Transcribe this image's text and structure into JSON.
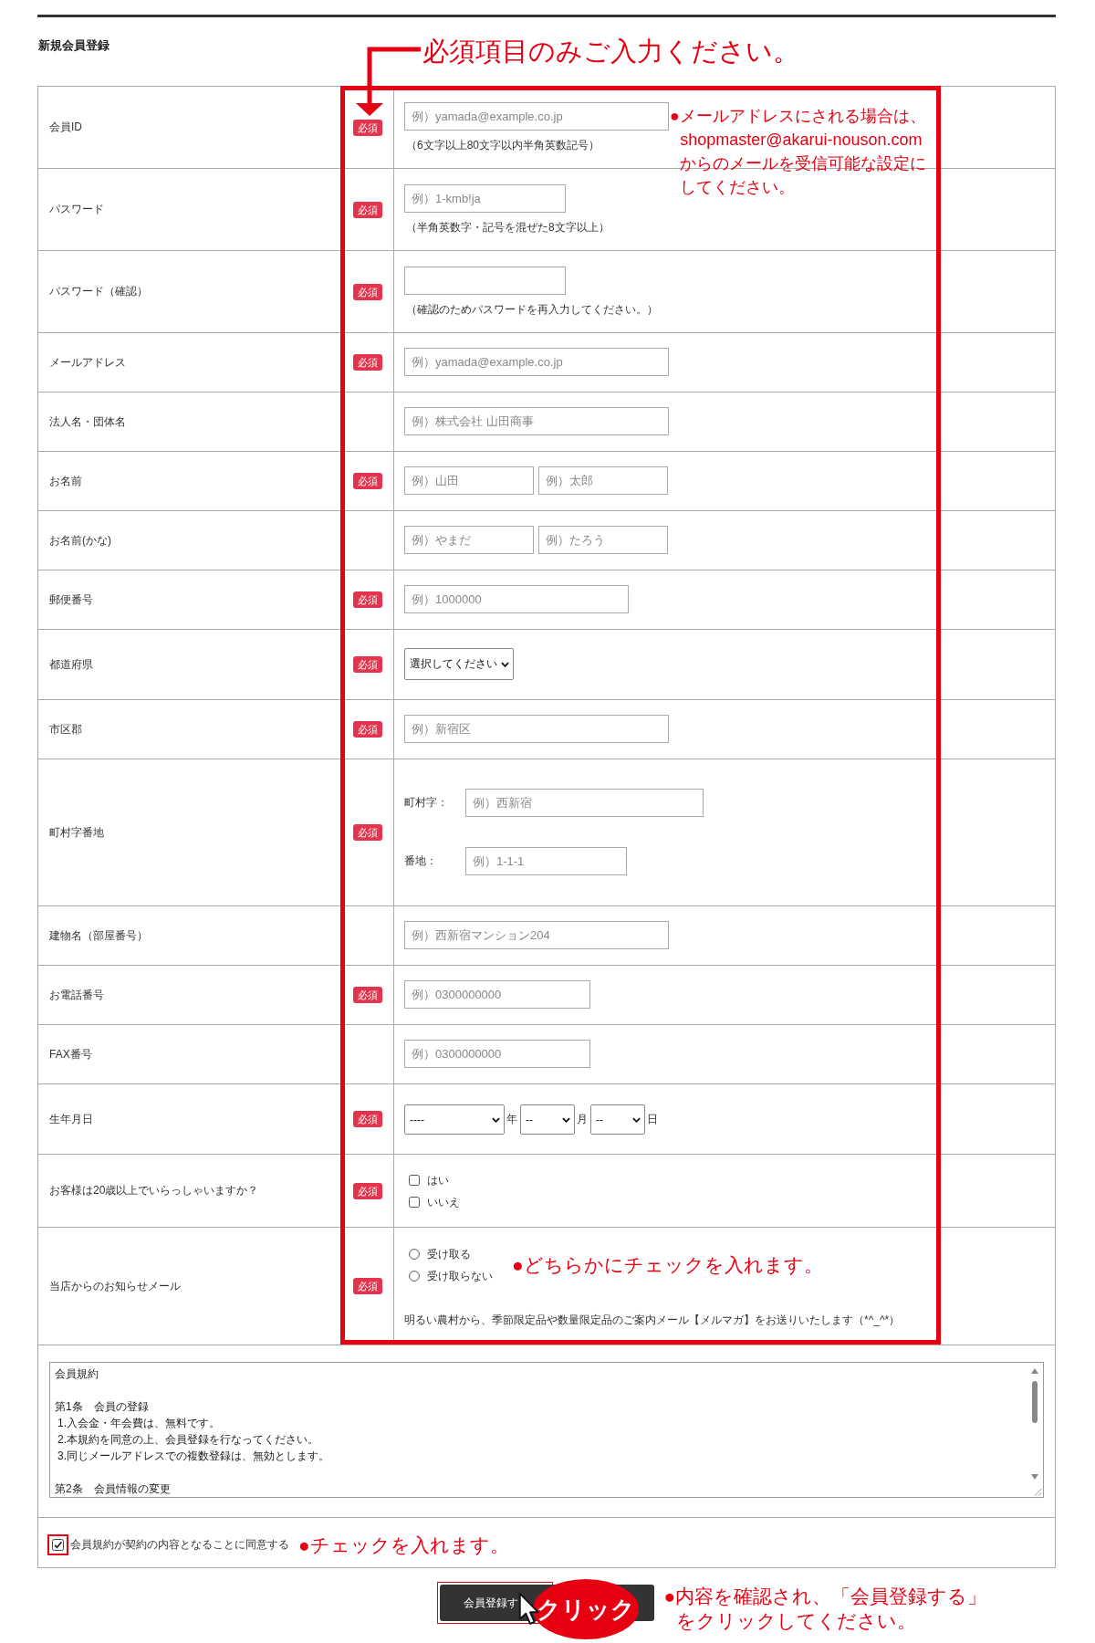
{
  "header": {
    "title": "新規会員登録",
    "required_note": "必須項目のみご入力ください。"
  },
  "form": {
    "highlighted": true,
    "rows": [
      {
        "label": "会員ID",
        "badge": "必須",
        "kind": "input",
        "fields": [
          {
            "kind": "email",
            "placeholder": "例）yamada@example.co.jp"
          }
        ],
        "hint": "（6文字以上80文字以内半角英数記号）",
        "callout": [
          "●メールアドレスにされる場合は、",
          "shopmaster@akarui-nouson.com",
          "からのメールを受信可能な設定に",
          "してください。"
        ]
      },
      {
        "label": "パスワード",
        "badge": "必須",
        "kind": "input",
        "fields": [
          {
            "kind": "password",
            "placeholder": "例）1-kmb!ja"
          }
        ],
        "hint": "（半角英数字・記号を混ぜた8文字以上）"
      },
      {
        "label": "パスワード（確認）",
        "badge": "必須",
        "kind": "input",
        "fields": [
          {
            "kind": "password"
          }
        ],
        "hint": "（確認のためパスワードを再入力してください。）"
      },
      {
        "label": "メールアドレス",
        "badge": "必須",
        "kind": "input",
        "fields": [
          {
            "kind": "email",
            "placeholder": "例）yamada@example.co.jp"
          }
        ]
      },
      {
        "label": "法人名・団体名",
        "kind": "input",
        "fields": [
          {
            "kind": "text",
            "placeholder": "例）株式会社 山田商事"
          }
        ]
      },
      {
        "label": "お名前",
        "badge": "必須",
        "kind": "input",
        "fields": [
          {
            "kind": "name",
            "placeholder": "例）山田"
          },
          {
            "kind": "name",
            "placeholder": "例）太郎"
          }
        ]
      },
      {
        "label": "お名前(かな)",
        "kind": "input",
        "fields": [
          {
            "kind": "name",
            "placeholder": "例）やまだ"
          },
          {
            "kind": "name",
            "placeholder": "例）たろう"
          }
        ]
      },
      {
        "label": "郵便番号",
        "badge": "必須",
        "kind": "input",
        "fields": [
          {
            "kind": "postal",
            "placeholder": "例）1000000"
          }
        ]
      },
      {
        "label": "都道府県",
        "badge": "必須",
        "kind": "select",
        "select": {
          "value": "選択してください"
        }
      },
      {
        "label": "市区郡",
        "badge": "必須",
        "kind": "input",
        "fields": [
          {
            "kind": "text",
            "placeholder": "例）新宿区"
          }
        ]
      },
      {
        "label": "町村字番地",
        "badge": "必須",
        "kind": "address",
        "parts": [
          {
            "label": "町村字：",
            "kind": "town",
            "placeholder": "例）西新宿"
          },
          {
            "label": "番地：",
            "kind": "lot",
            "placeholder": "例）1-1-1"
          }
        ]
      },
      {
        "label": "建物名（部屋番号）",
        "kind": "input",
        "fields": [
          {
            "kind": "text",
            "placeholder": "例）西新宿マンション204"
          }
        ]
      },
      {
        "label": "お電話番号",
        "badge": "必須",
        "kind": "input",
        "fields": [
          {
            "kind": "tel",
            "placeholder": "例）0300000000"
          }
        ]
      },
      {
        "label": "FAX番号",
        "kind": "input",
        "fields": [
          {
            "kind": "tel",
            "placeholder": "例）0300000000"
          }
        ]
      },
      {
        "label": "生年月日",
        "badge": "必須",
        "kind": "date",
        "selects": [
          {
            "kind": "year",
            "value": "----",
            "unit": "年"
          },
          {
            "kind": "month",
            "value": "--",
            "unit": "月"
          },
          {
            "kind": "day",
            "value": "--",
            "unit": "日"
          }
        ]
      },
      {
        "label": "お客様は20歳以上でいらっしゃいますか？",
        "badge": "必須",
        "kind": "checkboxes",
        "options": [
          {
            "label": "はい",
            "checked": false
          },
          {
            "label": "いいえ",
            "checked": false
          }
        ]
      },
      {
        "label": "当店からのお知らせメール",
        "badge": "必須",
        "kind": "radios",
        "options": [
          {
            "label": "受け取る",
            "selected": false
          },
          {
            "label": "受け取らない",
            "selected": false
          }
        ],
        "note": "明るい農村から、季節限定品や数量限定品のご案内メール【メルマガ】をお送りいたします（*^_^*）",
        "callout": [
          "●どちらかにチェックを入れます。"
        ]
      }
    ]
  },
  "terms": {
    "title": "会員規約",
    "sections": [
      {
        "heading": "第1条　会員の登録",
        "items": [
          "1.入会金・年会費は、無料です。",
          "2.本規約を同意の上、会員登録を行なってください。",
          "3.同じメールアドレスでの複数登録は、無効とします。"
        ]
      },
      {
        "heading": "第2条　会員情報の変更"
      }
    ]
  },
  "agreement": {
    "label": "会員規約が契約の内容となることに同意する",
    "checked": true,
    "highlighted": true,
    "callout": [
      "●チェックを入れます。"
    ]
  },
  "submit": {
    "label": "会員登録す",
    "highlighted": true,
    "click_badge": "クリック",
    "callout": [
      "●内容を確認され、「会員登録する」",
      "をクリックしてください。"
    ]
  }
}
